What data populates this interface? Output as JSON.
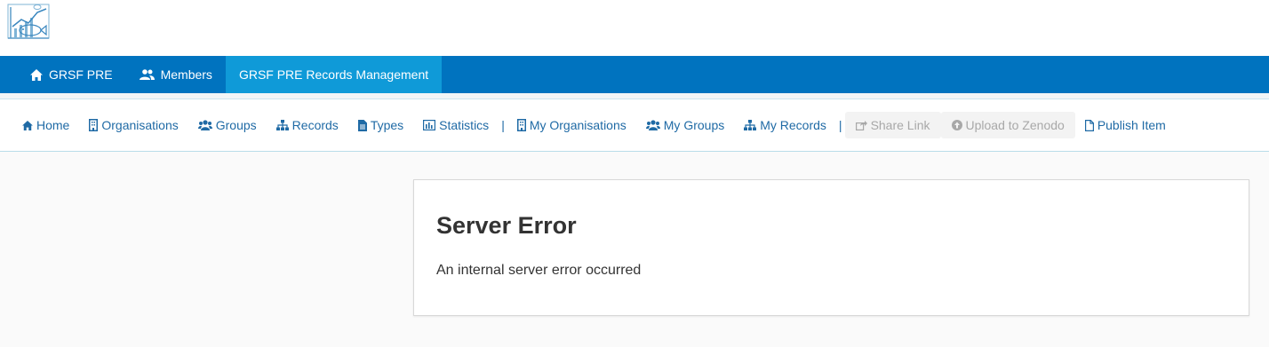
{
  "topnav": {
    "tabs": [
      {
        "label": "GRSF PRE",
        "icon": "home-icon"
      },
      {
        "label": "Members",
        "icon": "users-icon"
      },
      {
        "label": "GRSF PRE Records Management",
        "active": true
      }
    ],
    "colors": {
      "bar": "#0073bf",
      "active": "#0f9ad8"
    }
  },
  "subnav": {
    "items": [
      {
        "label": "Home",
        "icon": "home-icon"
      },
      {
        "label": "Organisations",
        "icon": "building-icon"
      },
      {
        "label": "Groups",
        "icon": "users-icon"
      },
      {
        "label": "Records",
        "icon": "sitemap-icon"
      },
      {
        "label": "Types",
        "icon": "file-icon"
      },
      {
        "label": "Statistics",
        "icon": "bar-chart-icon"
      },
      {
        "label": "My Organisations",
        "icon": "building-icon"
      },
      {
        "label": "My Groups",
        "icon": "users-icon"
      },
      {
        "label": "My Records",
        "icon": "sitemap-icon"
      },
      {
        "label": "Share Link",
        "icon": "share-icon",
        "disabled": true
      },
      {
        "label": "Upload to Zenodo",
        "icon": "upload-icon",
        "disabled": true
      },
      {
        "label": "Publish Item",
        "icon": "file-outline-icon"
      }
    ],
    "separator": "|",
    "link_color": "#1f6aa5"
  },
  "error": {
    "title": "Server Error",
    "message": "An internal server error occurred"
  }
}
